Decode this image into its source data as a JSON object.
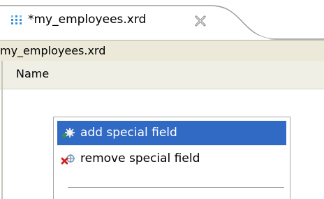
{
  "editor_tab": {
    "title": "*my_employees.xrd",
    "icon": "grid-dots-icon",
    "close_icon": "close-icon"
  },
  "path_bar": {
    "text": "my_employees.xrd"
  },
  "table": {
    "columns": [
      "Name"
    ]
  },
  "context_menu": {
    "items": [
      {
        "label": "add special field",
        "icon": "add-field-icon",
        "selected": true
      },
      {
        "label": "remove special field",
        "icon": "remove-field-icon",
        "selected": false
      }
    ]
  },
  "colors": {
    "selection": "#316ac5",
    "panel": "#ece9d8",
    "header": "#f0efe6"
  }
}
